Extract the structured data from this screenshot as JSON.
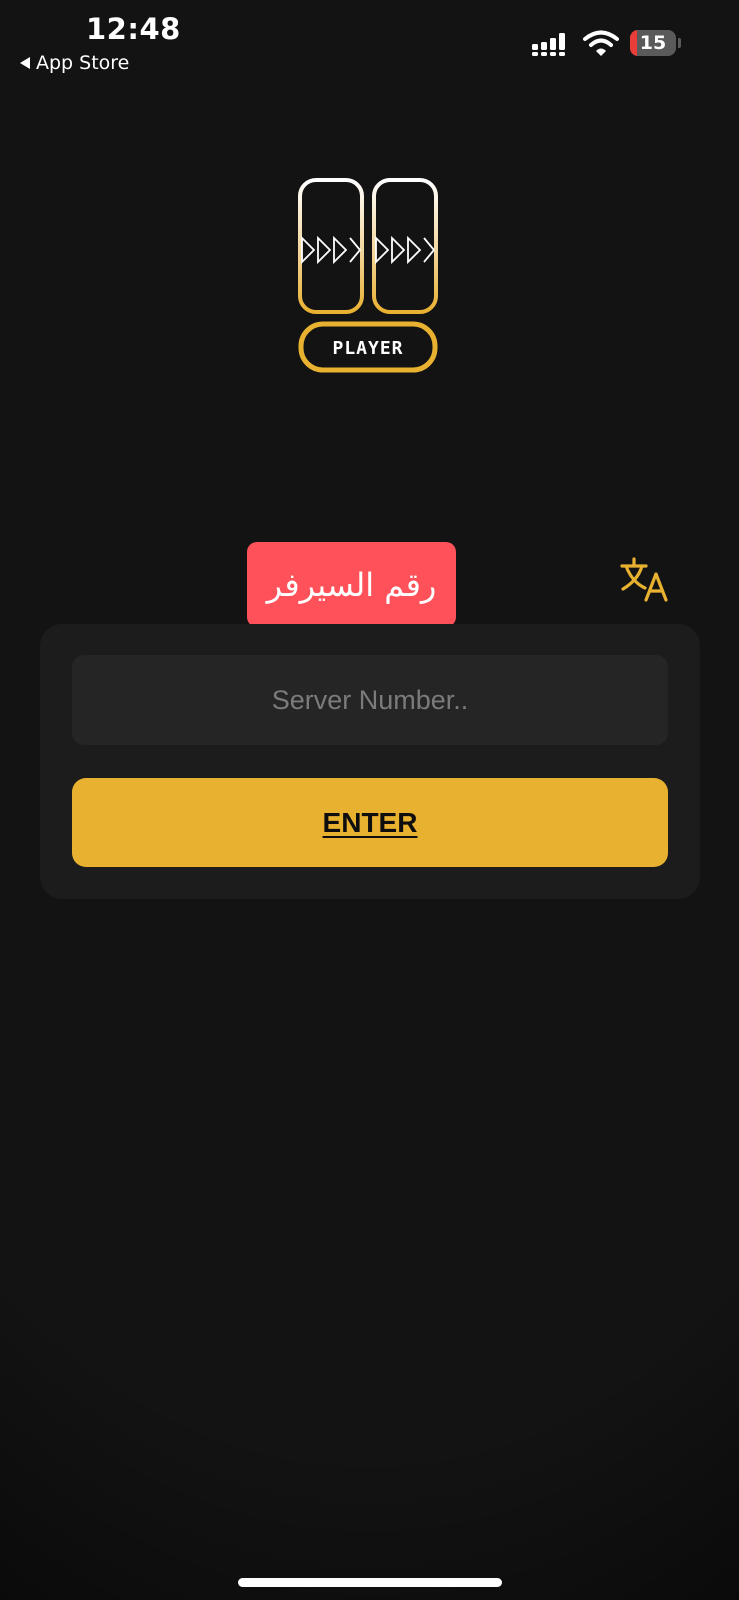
{
  "status_bar": {
    "time": "12:48",
    "back_label": "App Store",
    "battery_level": "15",
    "battery_fraction": 0.15
  },
  "logo": {
    "label": "PLAYER",
    "icon": "player-logo-icon"
  },
  "translate": {
    "icon": "translate-icon"
  },
  "server_badge": {
    "label": "رقم السيرفر"
  },
  "form": {
    "server_placeholder": "Server Number..",
    "server_value": "",
    "enter_label": "ENTER"
  },
  "colors": {
    "background": "#131313",
    "card": "#1c1c1c",
    "input": "#252525",
    "accent": "#e8b130",
    "badge": "#ff5159"
  }
}
